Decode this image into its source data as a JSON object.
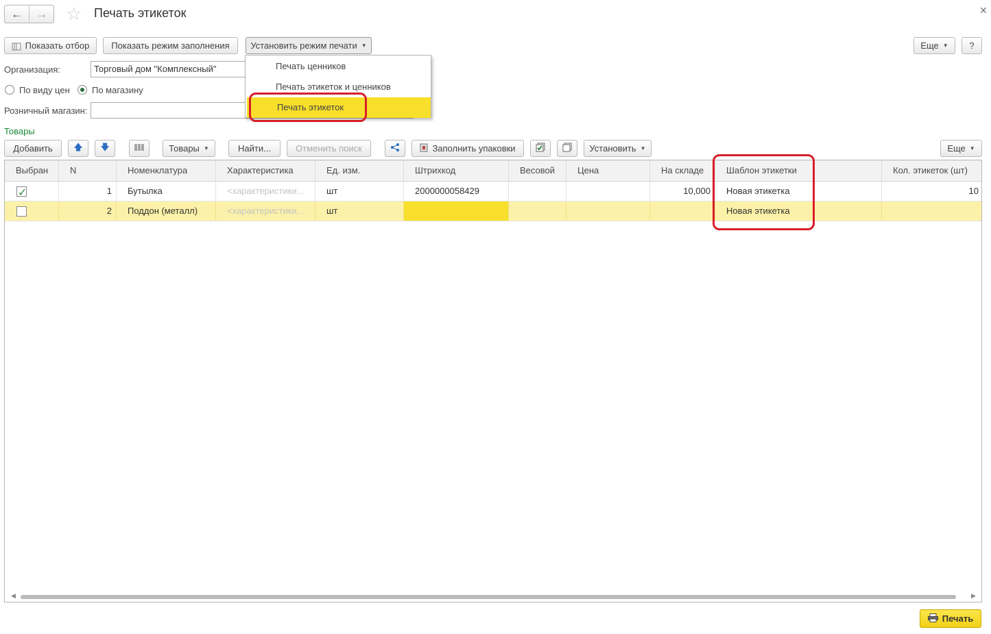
{
  "window": {
    "title": "Печать этикеток"
  },
  "toolbar": {
    "show_filter": "Показать отбор",
    "show_fill_mode": "Показать режим заполнения",
    "set_print_mode": "Установить режим печати",
    "more": "Еще",
    "help": "?"
  },
  "print_mode_menu": {
    "items": [
      {
        "label": "Печать ценников"
      },
      {
        "label": "Печать этикеток и ценников"
      },
      {
        "label": "Печать этикеток",
        "selected": true
      }
    ]
  },
  "form": {
    "organization_label": "Организация:",
    "organization_value": "Торговый дом \"Комплексный\"",
    "radio_by_price_type": "По виду цен",
    "radio_by_store": "По магазину",
    "radio_selected": "По магазину",
    "store_label": "Розничный магазин:",
    "store_value": ""
  },
  "goods": {
    "section_title": "Товары",
    "toolbar": {
      "add": "Добавить",
      "goods": "Товары",
      "find": "Найти...",
      "cancel_search": "Отменить поиск",
      "fill_packages": "Заполнить упаковки",
      "set": "Установить",
      "more": "Еще"
    },
    "columns": [
      "Выбран",
      "N",
      "Номенклатура",
      "Характеристика",
      "Ед. изм.",
      "Штрихкод",
      "Весовой",
      "Цена",
      "На складе",
      "Шаблон этикетки",
      "Кол. этикеток (шт)"
    ],
    "rows": [
      {
        "selected": true,
        "n": "1",
        "item": "Бутылка",
        "characteristic": "<характеристики...",
        "unit": "шт",
        "barcode": "2000000058429",
        "weighted": "",
        "price": "",
        "stock": "10,000",
        "template": "Новая этикетка",
        "labels_count": "10"
      },
      {
        "selected": false,
        "n": "2",
        "item": "Поддон (металл)",
        "characteristic": "<характеристики...",
        "unit": "шт",
        "barcode": "",
        "weighted": "",
        "price": "",
        "stock": "",
        "template": "Новая этикетка",
        "labels_count": ""
      }
    ]
  },
  "footer": {
    "print": "Печать"
  },
  "colors": {
    "accent_yellow": "#f7df2b",
    "highlight_red": "#d81e28",
    "section_green": "#1b8a3a",
    "selected_row": "#fcf1a8"
  }
}
